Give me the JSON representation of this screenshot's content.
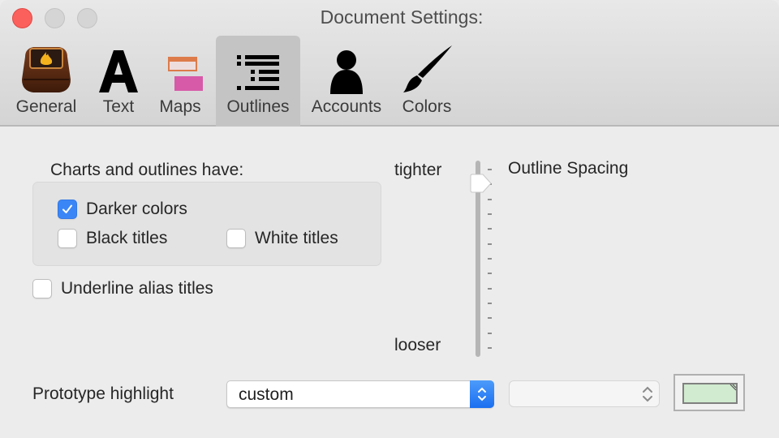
{
  "window": {
    "title": "Document Settings:",
    "controls": [
      "close",
      "minimize",
      "zoom"
    ]
  },
  "toolbar": {
    "tabs": [
      {
        "label": "General",
        "icon": "app-box-icon",
        "selected": false
      },
      {
        "label": "Text",
        "icon": "letter-a-icon",
        "selected": false
      },
      {
        "label": "Maps",
        "icon": "map-rectangles-icon",
        "selected": false
      },
      {
        "label": "Outlines",
        "icon": "outline-list-icon",
        "selected": true
      },
      {
        "label": "Accounts",
        "icon": "person-icon",
        "selected": false
      },
      {
        "label": "Colors",
        "icon": "paintbrush-icon",
        "selected": false
      }
    ]
  },
  "outlines": {
    "group_title": "Charts and outlines have:",
    "checkboxes": [
      {
        "label": "Darker colors",
        "checked": true
      },
      {
        "label": "Black titles",
        "checked": false
      },
      {
        "label": "White titles",
        "checked": false
      }
    ],
    "underline_alias": {
      "label": "Underline alias titles",
      "checked": false
    },
    "spacing": {
      "title": "Outline Spacing",
      "min_label": "tighter",
      "max_label": "looser",
      "tick_count": 13,
      "value_index": 1
    },
    "prototype_highlight": {
      "label": "Prototype highlight",
      "selected": "custom",
      "secondary_selected": "",
      "color": "#d0ebcf"
    }
  },
  "colors": {
    "accent": "#3b86f7",
    "close_button": "#fc605c",
    "maps_top": "#dd7b4a",
    "maps_bottom": "#d75aa8"
  }
}
